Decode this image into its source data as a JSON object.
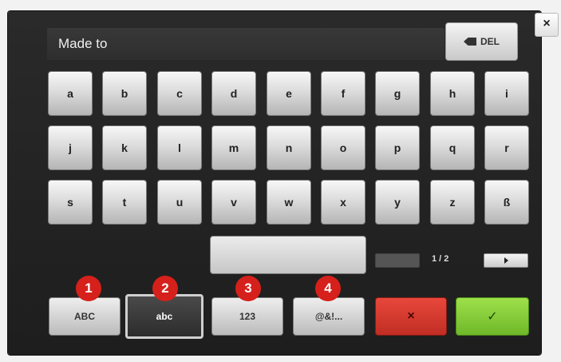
{
  "close_label": "×",
  "text_field": {
    "value": "Made to"
  },
  "del_label": "DEL",
  "keys": {
    "row1": [
      "a",
      "b",
      "c",
      "d",
      "e",
      "f",
      "g",
      "h",
      "i"
    ],
    "row2": [
      "j",
      "k",
      "l",
      "m",
      "n",
      "o",
      "p",
      "q",
      "r"
    ],
    "row3": [
      "s",
      "t",
      "u",
      "v",
      "w",
      "x",
      "y",
      "z",
      "ß"
    ]
  },
  "pagination": {
    "text": "1 / 2"
  },
  "modes": [
    {
      "label": "ABC",
      "badge": "1",
      "active": false
    },
    {
      "label": "abc",
      "badge": "2",
      "active": true
    },
    {
      "label": "123",
      "badge": "3",
      "active": false
    },
    {
      "label": "@&!...",
      "badge": "4",
      "active": false
    }
  ],
  "cancel_label": "×",
  "confirm_label": "✓",
  "colors": {
    "badge": "#d6201b",
    "cancel": "#d83a2f",
    "confirm": "#86cc38"
  },
  "icons": [
    "close-icon",
    "backspace-icon",
    "arrow-left-icon",
    "arrow-right-icon",
    "cancel-icon",
    "checkmark-icon"
  ]
}
